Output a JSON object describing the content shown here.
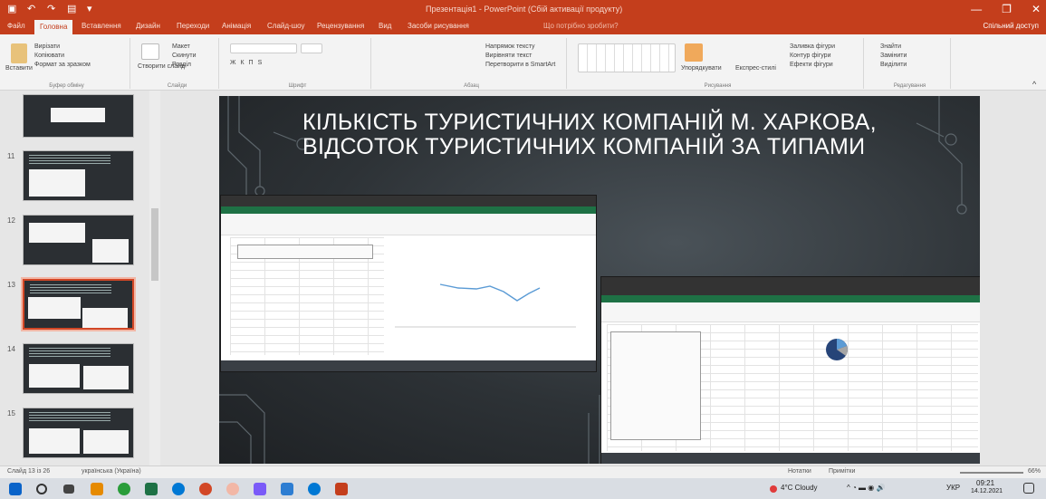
{
  "window": {
    "title": "Презентація1 - PowerPoint (Сбій активації продукту)",
    "controls": [
      "—",
      "❐",
      "✕"
    ]
  },
  "tabs": [
    {
      "label": "Файл"
    },
    {
      "label": "Головна",
      "active": true
    },
    {
      "label": "Вставлення"
    },
    {
      "label": "Дизайн"
    },
    {
      "label": "Переходи"
    },
    {
      "label": "Анімація"
    },
    {
      "label": "Слайд-шоу"
    },
    {
      "label": "Рецензування"
    },
    {
      "label": "Вид"
    },
    {
      "label": "Засоби рисування"
    }
  ],
  "tell_me": "Що потрібно зробити?",
  "share": "Спільний доступ",
  "ribbon": {
    "clipboard": {
      "paste": "Вставити",
      "cut": "Вирізати",
      "copy": "Копіювати",
      "format": "Формат за зразком",
      "label": "Буфер обміну"
    },
    "slides": {
      "new_slide": "Створити слайд",
      "layout": "Макет",
      "reset": "Скинути",
      "section": "Розділ",
      "label": "Слайди"
    },
    "font": {
      "label": "Шрифт"
    },
    "paragraph": {
      "text_direction": "Напрямок тексту",
      "align_text": "Вирівняти текст",
      "smartart": "Перетворити в SmartArt",
      "label": "Абзац"
    },
    "drawing": {
      "arrange": "Упорядкувати",
      "quick_styles": "Експрес-стилі",
      "fill": "Заливка фігури",
      "outline": "Контур фігури",
      "effects": "Ефекти фігури",
      "label": "Рисування"
    },
    "editing": {
      "find": "Знайти",
      "replace": "Замінити",
      "select": "Виділити",
      "label": "Редагування"
    }
  },
  "thumbnails": [
    {
      "num": "",
      "selected": false
    },
    {
      "num": "11",
      "selected": false
    },
    {
      "num": "12",
      "selected": false
    },
    {
      "num": "13",
      "selected": true
    },
    {
      "num": "14",
      "selected": false
    },
    {
      "num": "15",
      "selected": false
    }
  ],
  "slide": {
    "title": "КІЛЬКІСТЬ ТУРИСТИЧНИХ КОМПАНІЙ М. ХАРКОВА, ВІДСОТОК ТУРИСТИЧНИХ КОМПАНІЙ ЗА ТИПАМИ"
  },
  "statusbar": {
    "slide_info": "Слайд 13 із 26",
    "language": "українська (Україна)",
    "notes": "Нотатки",
    "comments": "Примітки",
    "zoom": "66%"
  },
  "taskbar": {
    "weather": "4°C Cloudy",
    "lang": "УКР",
    "time": "09:21",
    "date": "14.12.2021"
  },
  "colors": {
    "accent": "#c43e1c",
    "slide_bg": "#2d3236",
    "excel": "#1e7145"
  }
}
